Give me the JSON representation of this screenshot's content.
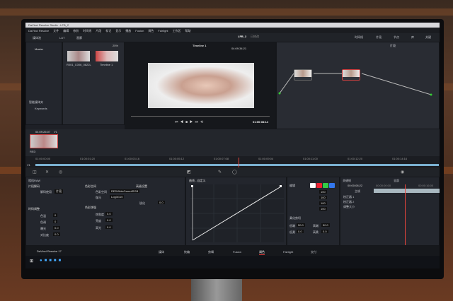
{
  "window_title": "DaVinci Resolve Studio - LFB_2",
  "menu": [
    "DaVinci Resolve",
    "文件",
    "编辑",
    "修剪",
    "时间线",
    "片段",
    "标记",
    "显示",
    "播放",
    "Fusion",
    "调色",
    "Fairlight",
    "工作区",
    "帮助"
  ],
  "toolbar": {
    "media_pool": "媒体池",
    "lut": "LUT",
    "gallery": "画廊",
    "zoom": "25%",
    "timeline_name": "Timeline 1",
    "project": "LFB_2",
    "project_status": "已修改",
    "source_timecode": "04:09:34:21",
    "right_buttons": [
      "时间线",
      "片段",
      "节点",
      "库",
      "关键"
    ],
    "clips_label": "片段"
  },
  "media_pool": {
    "bin": "Master",
    "smart_bins": "智能媒体夹",
    "keywords": "Keywords",
    "clips": [
      "R001_C006_0822L",
      "Timeline 1"
    ]
  },
  "viewer": {
    "timecode": "01:00:08:14"
  },
  "clip_strip": {
    "timecode": "04:09:26:07",
    "track": "V1",
    "clip_name": "RED"
  },
  "timeline_ruler": [
    "01:00:00:00",
    "01:00:01:20",
    "01:00:03:16",
    "01:00:05:12",
    "01:00:07:08",
    "01:00:09:04",
    "01:00:11:00",
    "01:00:12:20",
    "01:00:14:16"
  ],
  "track_label": "V1",
  "camera_raw": {
    "title": "相机RAW",
    "decode": "解码质量",
    "section1": "片段解码",
    "decode_using": "解码使用",
    "decode_value": "片段",
    "section2": "色彩空间",
    "colorspace": "色彩空间",
    "colorspace_value": "REDWideGamutRGB",
    "gamma": "伽马",
    "gamma_value": "Log3G10",
    "section3": "时码调整",
    "temp": "色温",
    "temp_val": "0",
    "tint": "色调",
    "tint_val": "0",
    "exposure": "曝光",
    "exposure_val": "0.0",
    "contrast": "对比度",
    "contrast_val": "0.0",
    "section4": "色彩增强",
    "sat": "饱和度",
    "sat_val": "0.0",
    "brightness": "亮度",
    "brightness_val": "0.0",
    "section5": "高级设置",
    "sharp": "锐化",
    "sharp_val": "0.0",
    "lift": "暗部",
    "mid": "中",
    "highlight": "高光",
    "highlight_val": "0.0"
  },
  "curves": {
    "title": "曲线 - 自定义"
  },
  "rgb": {
    "edit": "编辑",
    "values": [
      "100",
      "100",
      "100",
      "100"
    ],
    "soft_clip": "柔化剪切",
    "low": "低端",
    "low_val": "50.0",
    "high": "高端",
    "high_val": "50.0",
    "ls": "低柔",
    "ls_val": "0.0",
    "hs": "高柔",
    "hs_val": "0.0"
  },
  "keyframes": {
    "title": "关键帧",
    "all": "全部",
    "timecode": "00:00:08:22",
    "tc2": "00:00:00:00",
    "tc3": "00:00:16:00",
    "master": "主帧",
    "rows": [
      "校正器 1",
      "校正器 2",
      "调整大小"
    ]
  },
  "pages": [
    "媒体",
    "快编",
    "剪辑",
    "Fusion",
    "调色",
    "Fairlight",
    "交付"
  ],
  "app_name": "DaVinci Resolve 17",
  "colors": {
    "accent": "#e03a3a",
    "playhead": "#e8453c",
    "node_border": "#d04040"
  }
}
